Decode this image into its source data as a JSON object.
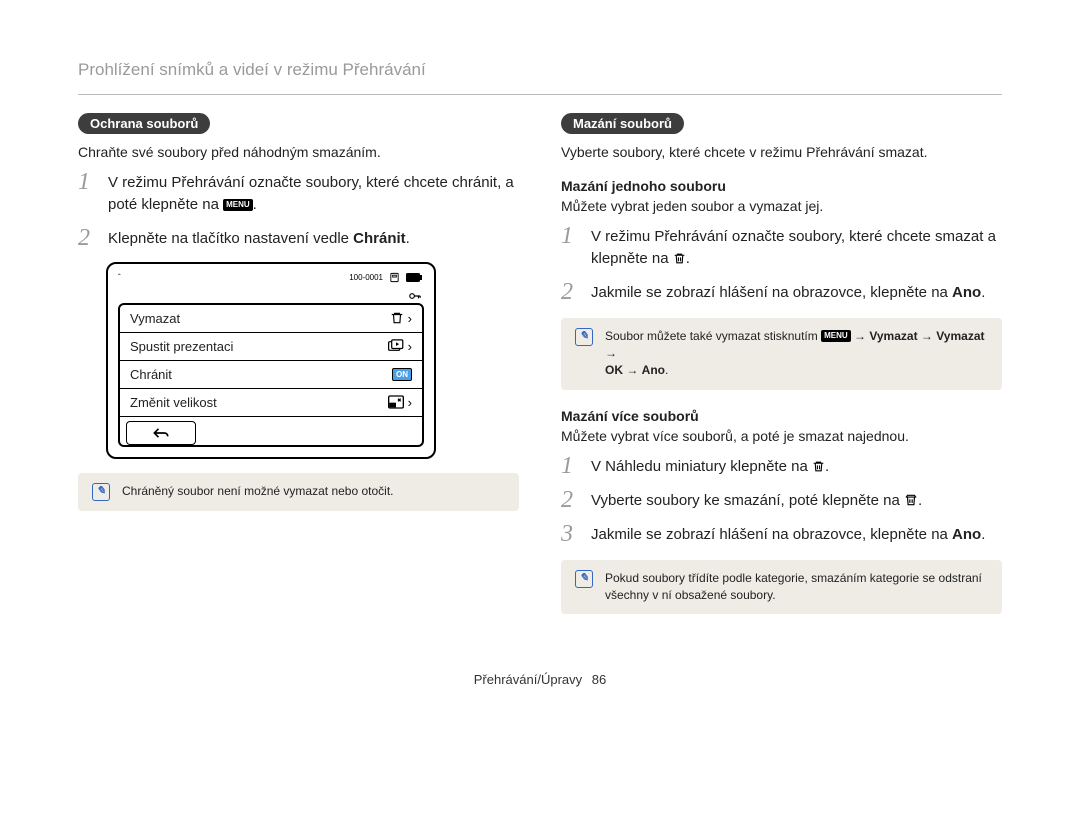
{
  "page": {
    "title": "Prohlížení snímků a videí v režimu Přehrávání",
    "footer_section": "Přehrávání/Úpravy",
    "footer_page": "86"
  },
  "icons": {
    "menu_label": "MENU",
    "info_glyph": "✎"
  },
  "left": {
    "heading": "Ochrana souborů",
    "lead": "Chraňte své soubory před náhodným smazáním.",
    "step1_a": "V režimu Přehrávání označte soubory, které chcete chránit, a poté klepněte na ",
    "step1_b": ".",
    "step2_a": "Klepněte na tlačítko nastavení vedle ",
    "step2_bold": "Chránit",
    "step2_b": ".",
    "figure": {
      "counter": "100-0001",
      "rows": {
        "delete": "Vymazat",
        "slideshow": "Spustit prezentaci",
        "protect": "Chránit",
        "resize": "Změnit velikost",
        "on": "ON"
      }
    },
    "note": "Chráněný soubor není možné vymazat nebo otočit."
  },
  "right": {
    "heading": "Mazání souborů",
    "lead": "Vyberte soubory, které chcete v režimu Přehrávání smazat.",
    "single": {
      "title": "Mazání jednoho souboru",
      "lead": "Můžete vybrat jeden soubor a vymazat jej.",
      "step1_a": "V režimu Přehrávání označte soubory, které chcete smazat a klepněte na ",
      "step1_b": ".",
      "step2_a": "Jakmile se zobrazí hlášení na obrazovce, klepněte na ",
      "step2_bold": "Ano",
      "step2_b": ".",
      "note_a": "Soubor můžete také vymazat stisknutím ",
      "note_b": " → ",
      "note_c": "Vymazat",
      "note_d": " → ",
      "note_e": "Vymazat",
      "note_f": " → ",
      "note_g": "OK",
      "note_h": " → ",
      "note_i": "Ano",
      "note_j": "."
    },
    "multi": {
      "title": "Mazání více souborů",
      "lead": "Můžete vybrat více souborů, a poté je smazat najednou.",
      "step1_a": "V Náhledu miniatury klepněte na ",
      "step1_b": ".",
      "step2_a": "Vyberte soubory ke smazání, poté klepněte na ",
      "step2_b": ".",
      "step3_a": "Jakmile se zobrazí hlášení na obrazovce, klepněte na ",
      "step3_bold": "Ano",
      "step3_b": ".",
      "note": "Pokud soubory třídíte podle kategorie, smazáním kategorie se odstraní všechny v ní obsažené soubory."
    }
  }
}
